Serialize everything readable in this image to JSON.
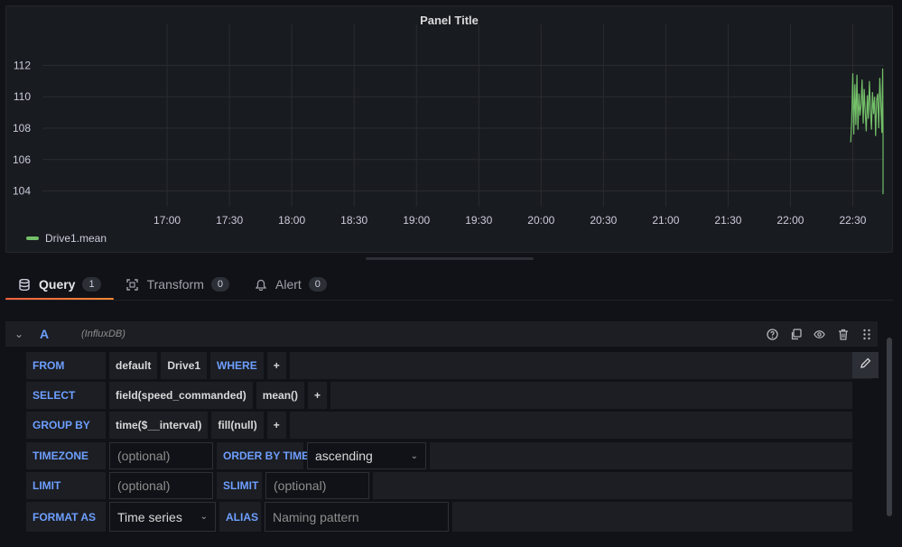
{
  "panel": {
    "title": "Panel Title"
  },
  "chart_data": {
    "type": "line",
    "title": "Panel Title",
    "x_ticks": [
      "17:00",
      "17:30",
      "18:00",
      "18:30",
      "19:00",
      "19:30",
      "20:00",
      "20:30",
      "21:00",
      "21:30",
      "22:00",
      "22:30"
    ],
    "y_ticks": [
      104,
      106,
      108,
      110,
      112
    ],
    "ylim": [
      103,
      113
    ],
    "xlim_minutes": [
      960,
      1365
    ],
    "grid": true,
    "legend_position": "bottom-left",
    "series": [
      {
        "name": "Drive1.mean",
        "color": "#73bf69",
        "x": [
          "22:29",
          "22:29.5",
          "22:30",
          "22:30.5",
          "22:31",
          "22:31.5",
          "22:32",
          "22:32.5",
          "22:33",
          "22:33.5",
          "22:34",
          "22:34.5",
          "22:35",
          "22:35.5",
          "22:36",
          "22:36.5",
          "22:37",
          "22:37.5",
          "22:38",
          "22:38.5",
          "22:39",
          "22:39.5",
          "22:40",
          "22:40.5",
          "22:41",
          "22:41.5",
          "22:42",
          "22:42.5",
          "22:43",
          "22:43.5",
          "22:44",
          "22:44.5",
          "22:45",
          "22:45.5",
          "22:46"
        ],
        "values": [
          107.1,
          108.5,
          111.5,
          107.6,
          110.8,
          108.2,
          111.4,
          107.9,
          110.2,
          108.8,
          109.5,
          111.1,
          108.3,
          110.5,
          109.0,
          107.8,
          110.1,
          108.6,
          111.0,
          109.2,
          107.9,
          110.3,
          108.9,
          110.0,
          107.5,
          109.8,
          110.2,
          108.0,
          111.2,
          109.6,
          107.7,
          110.4,
          111.8,
          107.3,
          103.8
        ],
        "x_minutes": [
          1349,
          1349.5,
          1350,
          1350.5,
          1351,
          1351.5,
          1352,
          1352.5,
          1353,
          1353.5,
          1354,
          1354.5,
          1355,
          1355.5,
          1356,
          1356.5,
          1357,
          1357.5,
          1358,
          1358.5,
          1359,
          1359.5,
          1360,
          1360.5,
          1361,
          1361.5,
          1362,
          1362.5,
          1363,
          1363.5,
          1364,
          1364.2,
          1364.4,
          1364.7,
          1365
        ]
      }
    ]
  },
  "tabs": [
    {
      "label": "Query",
      "count": "1",
      "icon": "database-icon"
    },
    {
      "label": "Transform",
      "count": "0",
      "icon": "transform-icon"
    },
    {
      "label": "Alert",
      "count": "0",
      "icon": "bell-icon"
    }
  ],
  "query": {
    "ref_id": "A",
    "datasource": "(InfluxDB)",
    "from": {
      "label": "FROM",
      "policy": "default",
      "measurement": "Drive1",
      "where": "WHERE",
      "add": "+"
    },
    "select": {
      "label": "SELECT",
      "field": "field(speed_commanded)",
      "agg": "mean()",
      "add": "+"
    },
    "group_by": {
      "label": "GROUP BY",
      "time": "time($__interval)",
      "fill": "fill(null)",
      "add": "+"
    },
    "timezone": {
      "label": "TIMEZONE",
      "placeholder": "(optional)",
      "order_label": "ORDER BY TIME",
      "order_value": "ascending"
    },
    "limit": {
      "label": "LIMIT",
      "placeholder": "(optional)",
      "slimit_label": "SLIMIT",
      "slimit_placeholder": "(optional)"
    },
    "format": {
      "label": "FORMAT AS",
      "value": "Time series",
      "alias_label": "ALIAS",
      "alias_placeholder": "Naming pattern"
    }
  }
}
